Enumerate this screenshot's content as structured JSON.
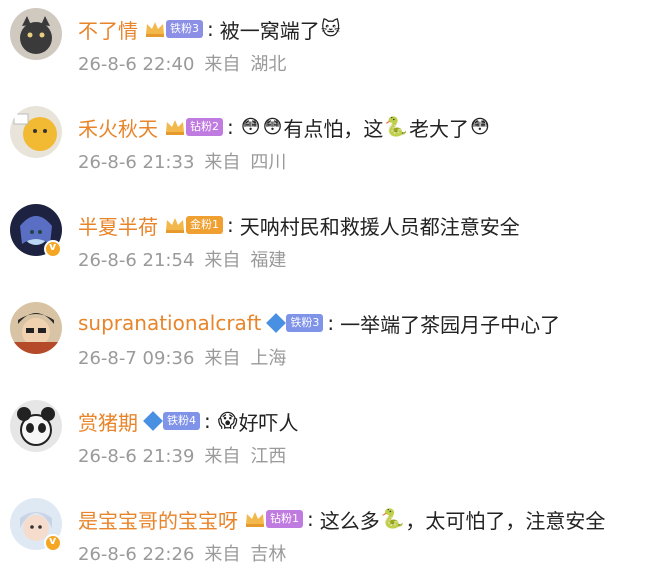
{
  "comments": [
    {
      "name": "不了情",
      "badge": "铁粉3",
      "badge_icon": "crown-icon",
      "badge_color": "#8b8fe6",
      "content_parts": [
        "被一窝端了",
        "🐱"
      ],
      "date": "26-8-6 22:40",
      "from_label": "来自",
      "location": "湖北",
      "verified": false
    },
    {
      "name": "禾火秋天",
      "badge": "钻粉2",
      "badge_icon": "crown-icon",
      "badge_color": "#c07be0",
      "content_parts": [
        "😳",
        "😳",
        "有点怕，这",
        "🐍",
        "老大了",
        "😳"
      ],
      "date": "26-8-6 21:33",
      "from_label": "来自",
      "location": "四川",
      "verified": false
    },
    {
      "name": "半夏半荷",
      "badge": "金粉1",
      "badge_icon": "crown-icon",
      "badge_color": "#f0a030",
      "content_parts": [
        "天呐村民和救援人员都注意安全"
      ],
      "date": "26-8-6 21:54",
      "from_label": "来自",
      "location": "福建",
      "verified": true
    },
    {
      "name": "supranationalcraft",
      "badge": "铁粉3",
      "badge_icon": "diamond-icon",
      "badge_color": "#7f93e8",
      "content_parts": [
        "一举端了茶园月子中心了"
      ],
      "date": "26-8-7 09:36",
      "from_label": "来自",
      "location": "上海",
      "verified": false
    },
    {
      "name": "赏猪期",
      "badge": "铁粉4",
      "badge_icon": "diamond-icon",
      "badge_color": "#7f93e8",
      "content_parts": [
        "😱",
        "好吓人"
      ],
      "date": "26-8-6 21:39",
      "from_label": "来自",
      "location": "江西",
      "verified": false
    },
    {
      "name": "是宝宝哥的宝宝呀",
      "badge": "钻粉1",
      "badge_icon": "crown-icon",
      "badge_color": "#c07be0",
      "content_parts": [
        "这么多",
        "🐍",
        "，太可怕了，注意安全"
      ],
      "date": "26-8-6 22:26",
      "from_label": "来自",
      "location": "吉林",
      "verified": true
    }
  ]
}
